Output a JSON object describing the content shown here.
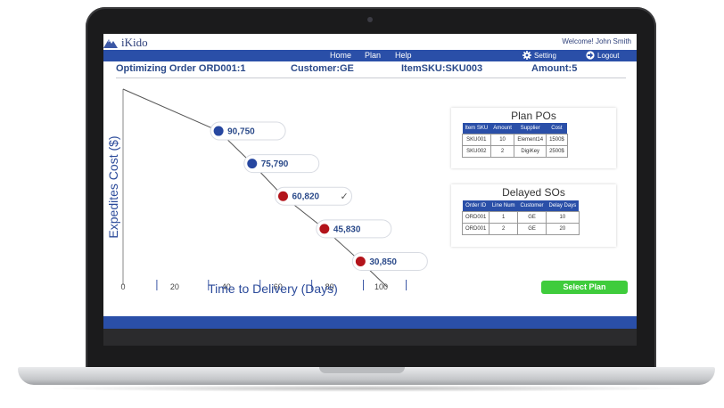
{
  "app": {
    "logo_text": "iKido",
    "welcome_text": "Welcome! John Smith"
  },
  "nav": {
    "home": "Home",
    "plan": "Plan",
    "help": "Help",
    "setting": "Setting",
    "logout": "Logout"
  },
  "order": {
    "title": "Optimizing Order ORD001:1",
    "customer": "Customer:GE",
    "item_sku": "ItemSKU:SKU003",
    "amount": "Amount:5"
  },
  "chart_data": {
    "type": "scatter",
    "xlabel": "Time to Delivery (Days)",
    "ylabel": "Expedites Cost ($)",
    "x_ticks": [
      "0",
      "20",
      "40",
      "60",
      "80",
      "100"
    ],
    "points": [
      {
        "label": "90,750",
        "x": 37,
        "y": 90750,
        "color": "#2747a0",
        "selected": false
      },
      {
        "label": "75,790",
        "x": 50,
        "y": 75790,
        "color": "#2747a0",
        "selected": false
      },
      {
        "label": "60,820",
        "x": 62,
        "y": 60820,
        "color": "#b3141b",
        "selected": true
      },
      {
        "label": "45,830",
        "x": 78,
        "y": 45830,
        "color": "#b3141b",
        "selected": false
      },
      {
        "label": "30,850",
        "x": 92,
        "y": 30850,
        "color": "#b3141b",
        "selected": false
      }
    ],
    "selected_mark": "✓",
    "grid": false
  },
  "plan_pos": {
    "title": "Plan POs",
    "headers": [
      "Item SKU",
      "Amount",
      "Supplier",
      "Cost"
    ],
    "rows": [
      [
        "SKU001",
        "10",
        "Element14",
        "1500$"
      ],
      [
        "SKU002",
        "2",
        "DigiKey",
        "2500$"
      ]
    ]
  },
  "delayed_sos": {
    "title": "Delayed SOs",
    "headers": [
      "Order ID",
      "Line Num",
      "Customer",
      "Delay Days"
    ],
    "rows": [
      [
        "ORD001",
        "1",
        "GE",
        "10"
      ],
      [
        "ORD001",
        "2",
        "GE",
        "20"
      ]
    ]
  },
  "actions": {
    "select_plan": "Select Plan"
  },
  "colors": {
    "brand_blue": "#2a4fa8",
    "accent_green": "#3fcc3c",
    "high_cost_red": "#b3141b"
  },
  "icons": {
    "logo": "mountain-logo-icon",
    "setting": "gear-icon",
    "logout": "logout-arrow-icon",
    "check": "check-icon"
  }
}
